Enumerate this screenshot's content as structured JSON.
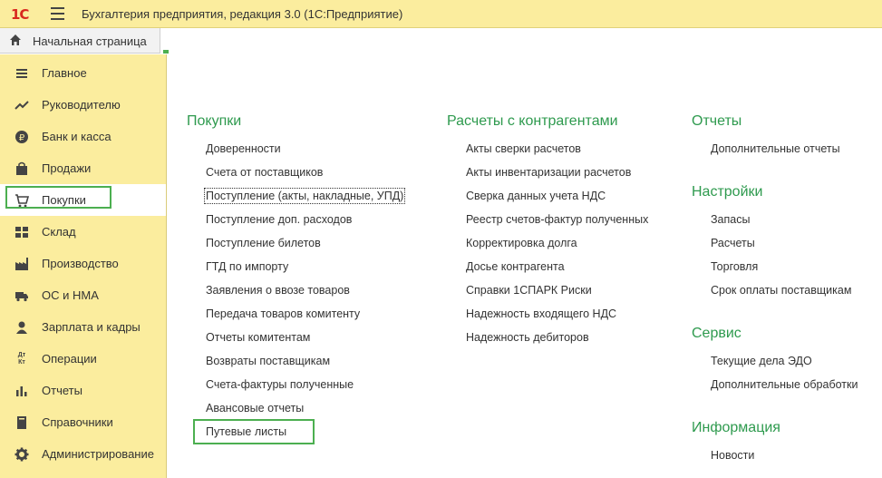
{
  "app": {
    "logo": "1С",
    "title": "Бухгалтерия предприятия, редакция 3.0  (1С:Предприятие)"
  },
  "tabs": {
    "home_label": "Начальная страница"
  },
  "sidebar": {
    "items": [
      {
        "label": "Главное",
        "icon": "menu-icon"
      },
      {
        "label": "Руководителю",
        "icon": "trend-icon"
      },
      {
        "label": "Банк и касса",
        "icon": "ruble-icon"
      },
      {
        "label": "Продажи",
        "icon": "bag-icon"
      },
      {
        "label": "Покупки",
        "icon": "cart-icon",
        "active": true
      },
      {
        "label": "Склад",
        "icon": "grid-icon"
      },
      {
        "label": "Производство",
        "icon": "factory-icon"
      },
      {
        "label": "ОС и НМА",
        "icon": "truck-icon"
      },
      {
        "label": "Зарплата и кадры",
        "icon": "person-icon"
      },
      {
        "label": "Операции",
        "icon": "dt-kt-icon"
      },
      {
        "label": "Отчеты",
        "icon": "bar-chart-icon"
      },
      {
        "label": "Справочники",
        "icon": "book-icon"
      },
      {
        "label": "Администрирование",
        "icon": "gear-icon"
      }
    ],
    "dt_kt_text": "Дт Кт"
  },
  "content": {
    "purchases": {
      "title": "Покупки",
      "links": [
        "Доверенности",
        "Счета от поставщиков",
        "Поступление (акты, накладные, УПД)",
        "Поступление доп. расходов",
        "Поступление билетов",
        "ГТД по импорту",
        "Заявления о ввозе товаров",
        "Передача товаров комитенту",
        "Отчеты комитентам",
        "Возвраты поставщикам",
        "Счета-фактуры полученные",
        "Авансовые отчеты",
        "Путевые листы"
      ]
    },
    "settlements": {
      "title": "Расчеты с контрагентами",
      "links": [
        "Акты сверки расчетов",
        "Акты инвентаризации расчетов",
        "Сверка данных учета НДС",
        "Реестр счетов-фактур полученных",
        "Корректировка долга",
        "Досье контрагента",
        "Справки 1СПАРК Риски",
        "Надежность входящего НДС",
        "Надежность дебиторов"
      ]
    },
    "reports": {
      "title": "Отчеты",
      "links": [
        "Дополнительные отчеты"
      ]
    },
    "settings": {
      "title": "Настройки",
      "links": [
        "Запасы",
        "Расчеты",
        "Торговля",
        "Срок оплаты поставщикам"
      ]
    },
    "service": {
      "title": "Сервис",
      "links": [
        "Текущие дела ЭДО",
        "Дополнительные обработки"
      ]
    },
    "info": {
      "title": "Информация",
      "links": [
        "Новости"
      ]
    }
  }
}
